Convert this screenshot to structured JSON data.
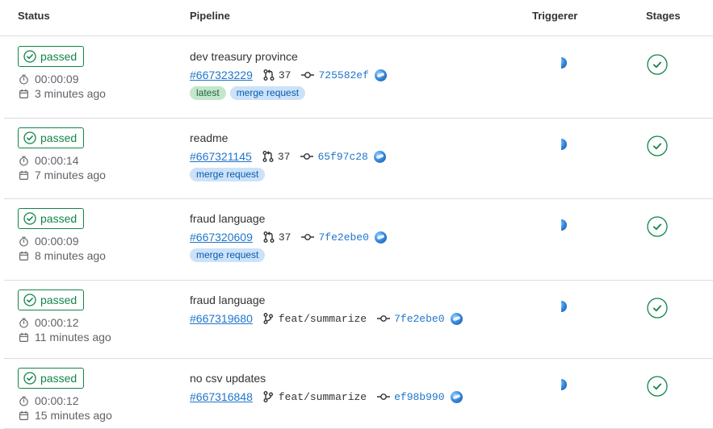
{
  "header": {
    "status": "Status",
    "pipeline": "Pipeline",
    "triggerer": "Triggerer",
    "stages": "Stages"
  },
  "colors": {
    "passed": "#108548",
    "link": "#1f75cb",
    "tag_latest_bg": "#c3e6cd",
    "tag_mr_bg": "#cbe2f9"
  },
  "pipelines": [
    {
      "status": "passed",
      "duration": "00:00:09",
      "finished": "3 minutes ago",
      "title": "dev treasury province",
      "id": "#667323229",
      "ref_type": "merge-request",
      "ref": "37",
      "sha": "725582ef",
      "tags": [
        "latest",
        "merge request"
      ]
    },
    {
      "status": "passed",
      "duration": "00:00:14",
      "finished": "7 minutes ago",
      "title": "readme",
      "id": "#667321145",
      "ref_type": "merge-request",
      "ref": "37",
      "sha": "65f97c28",
      "tags": [
        "merge request"
      ]
    },
    {
      "status": "passed",
      "duration": "00:00:09",
      "finished": "8 minutes ago",
      "title": "fraud language",
      "id": "#667320609",
      "ref_type": "merge-request",
      "ref": "37",
      "sha": "7fe2ebe0",
      "tags": [
        "merge request"
      ]
    },
    {
      "status": "passed",
      "duration": "00:00:12",
      "finished": "11 minutes ago",
      "title": "fraud language",
      "id": "#667319680",
      "ref_type": "branch",
      "ref": "feat/summarize",
      "sha": "7fe2ebe0",
      "tags": []
    },
    {
      "status": "passed",
      "duration": "00:00:12",
      "finished": "15 minutes ago",
      "title": "no csv updates",
      "id": "#667316848",
      "ref_type": "branch",
      "ref": "feat/summarize",
      "sha": "ef98b990",
      "tags": []
    }
  ]
}
